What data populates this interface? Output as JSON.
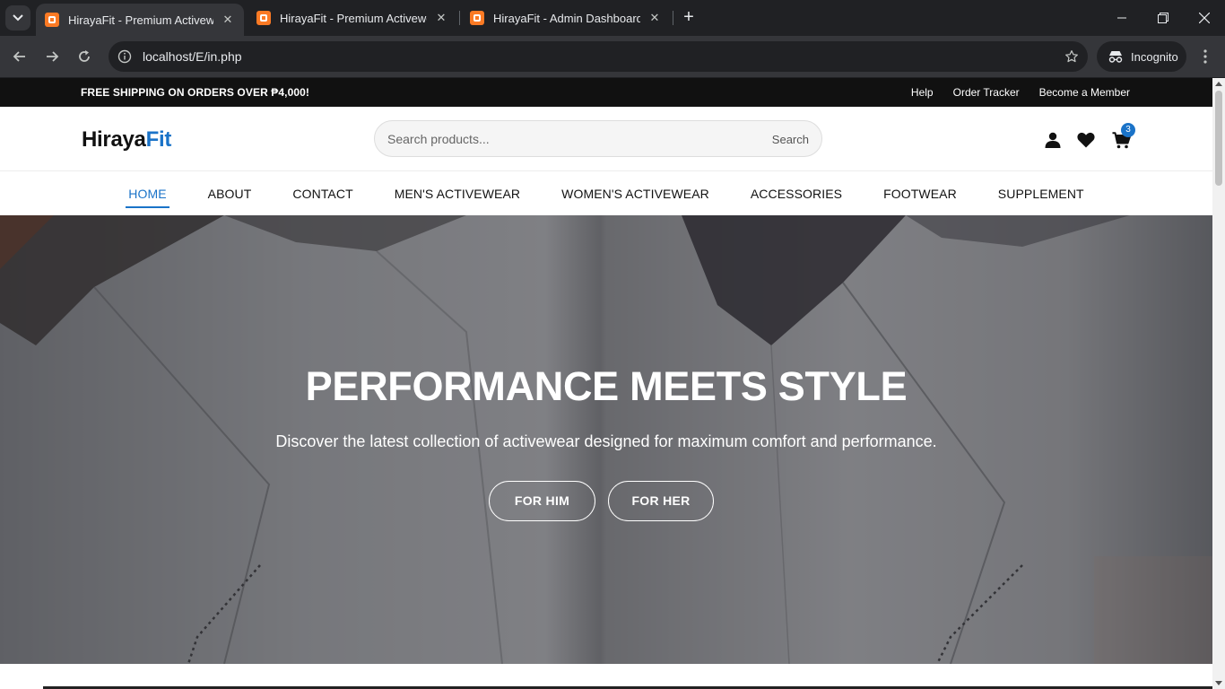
{
  "browser": {
    "tabs": [
      {
        "title": "HirayaFit - Premium Activewear",
        "active": true
      },
      {
        "title": "HirayaFit - Premium Activewear",
        "active": false
      },
      {
        "title": "HirayaFit - Admin Dashboard",
        "active": false
      }
    ],
    "url": "localhost/E/in.php",
    "profile_label": "Incognito",
    "icons": [
      "tab-search-icon",
      "favicon",
      "close-icon",
      "new-tab-icon",
      "minimize-icon",
      "restore-icon",
      "close-window-icon",
      "back-icon",
      "forward-icon",
      "reload-icon",
      "site-info-icon",
      "star-icon",
      "incognito-icon",
      "menu-icon"
    ]
  },
  "announcement": {
    "text": "FREE SHIPPING ON ORDERS OVER ₱4,000!",
    "links": [
      "Help",
      "Order Tracker",
      "Become a Member"
    ]
  },
  "header": {
    "logo_main": "Hiraya",
    "logo_accent": "Fit",
    "search_placeholder": "Search products...",
    "search_button": "Search",
    "cart_count": "3",
    "icons": [
      "user-icon",
      "heart-icon",
      "cart-icon"
    ]
  },
  "nav": {
    "items": [
      "HOME",
      "ABOUT",
      "CONTACT",
      "MEN'S ACTIVEWEAR",
      "WOMEN'S ACTIVEWEAR",
      "ACCESSORIES",
      "FOOTWEAR",
      "SUPPLEMENT"
    ],
    "active": "HOME"
  },
  "hero": {
    "title": "PERFORMANCE MEETS STYLE",
    "subtitle": "Discover the latest collection of activewear designed for maximum comfort and performance.",
    "buttons": [
      "FOR HIM",
      "FOR HER"
    ]
  },
  "colors": {
    "accent": "#1a73c8",
    "announcement_bg": "#111111",
    "chrome_dark": "#202124",
    "chrome_toolbar": "#35363a",
    "favicon": "#fb7a24"
  }
}
